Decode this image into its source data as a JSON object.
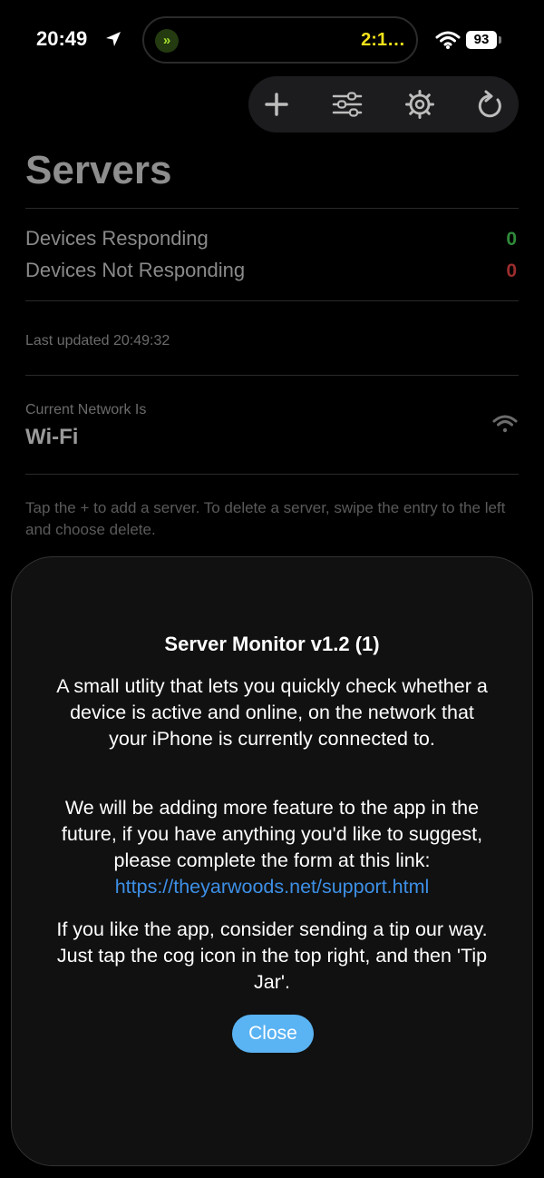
{
  "status_bar": {
    "time": "20:49",
    "island_timer": "2:1…",
    "battery": "93"
  },
  "toolbar": {
    "icons": [
      "add-icon",
      "filter-sliders-icon",
      "gear-icon",
      "refresh-icon"
    ]
  },
  "page": {
    "title": "Servers"
  },
  "stats": {
    "responding_label": "Devices Responding",
    "responding_value": "0",
    "not_responding_label": "Devices Not Responding",
    "not_responding_value": "0",
    "responding_color": "#2f8a3a",
    "not_responding_color": "#9a2d2d"
  },
  "last_updated": "Last updated 20:49:32",
  "network": {
    "label": "Current Network Is",
    "value": "Wi-Fi"
  },
  "hint": "Tap the + to add a server. To delete a server, swipe the entry to the left and choose delete.",
  "modal": {
    "title": "Server Monitor v1.2 (1)",
    "para1": "A small utlity that lets you quickly check whether a device is active and online, on the network that your iPhone is currently connected to.",
    "para2": "We will be adding more feature to the app in the future, if you have anything you'd like to suggest, please complete the form at this link:",
    "link": "https://theyarwoods.net/support.html",
    "para3": "If you like the app, consider sending a tip our way. Just tap the cog icon in the top right, and then 'Tip Jar'.",
    "close_label": "Close",
    "link_color": "#3d8fe6",
    "button_color": "#5ab3f2"
  }
}
